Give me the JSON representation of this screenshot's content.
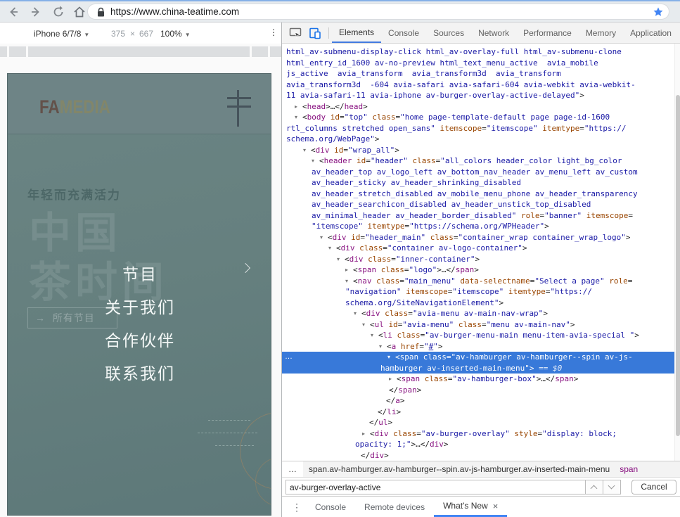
{
  "browser": {
    "url": "https://www.china-teatime.com",
    "bookmarked_star_color": "#4285f4"
  },
  "device_toolbar": {
    "device": "iPhone 6/7/8",
    "width": "375",
    "times": "×",
    "height": "667",
    "zoom": "100%"
  },
  "viewport": {
    "logo_part1": "FA",
    "logo_part2": "MEDIA",
    "tagline": "年轻而充满活力",
    "hero_line1": "中国",
    "hero_line2": "茶时间",
    "cta_arrow": "→",
    "cta_label": "所有节目",
    "menu": [
      "节目",
      "关于我们",
      "合作伙伴",
      "联系我们"
    ]
  },
  "devtools": {
    "accent_color": "#4285f4",
    "selection_color": "#3879d9",
    "tabs": [
      {
        "label": "Elements",
        "selected": true
      },
      {
        "label": "Console"
      },
      {
        "label": "Sources"
      },
      {
        "label": "Network"
      },
      {
        "label": "Performance"
      },
      {
        "label": "Memory"
      },
      {
        "label": "Application"
      }
    ],
    "code_lines": [
      {
        "ind": 6,
        "seg": [
          [
            "val",
            "html_av-submenu-display-click html_av-overlay-full html_av-submenu-clone"
          ]
        ]
      },
      {
        "ind": 6,
        "seg": [
          [
            "val",
            "html_entry_id_1600 av-no-preview html_text_menu_active  avia_mobile"
          ]
        ]
      },
      {
        "ind": 6,
        "seg": [
          [
            "val",
            "js_active  avia_transform  avia_transform3d  avia_transform"
          ]
        ]
      },
      {
        "ind": 6,
        "seg": [
          [
            "val",
            "avia_transform3d  -604 avia-safari avia-safari-604 avia-webkit avia-webkit-"
          ]
        ]
      },
      {
        "ind": 6,
        "seg": [
          [
            "val",
            "11 avia-safari-11 avia-iphone av-burger-overlay-active-delayed\""
          ],
          [
            "p",
            ">"
          ]
        ]
      },
      {
        "ind": 18,
        "seg": [
          [
            "arr",
            "▸"
          ],
          [
            "p",
            "<"
          ],
          [
            "tag",
            "head"
          ],
          [
            "p",
            ">…</"
          ],
          [
            "tag",
            "head"
          ],
          [
            "p",
            ">"
          ]
        ]
      },
      {
        "ind": 18,
        "seg": [
          [
            "arr",
            "▾"
          ],
          [
            "p",
            "<"
          ],
          [
            "tag",
            "body"
          ],
          [
            "p",
            " "
          ],
          [
            "attr",
            "id"
          ],
          [
            "p",
            "="
          ],
          [
            "val",
            "\"top\""
          ],
          [
            "p",
            " "
          ],
          [
            "attr",
            "class"
          ],
          [
            "p",
            "="
          ],
          [
            "val",
            "\"home page-template-default page page-id-1600"
          ]
        ]
      },
      {
        "ind": 6,
        "seg": [
          [
            "val",
            "rtl_columns stretched open_sans\""
          ],
          [
            "p",
            " "
          ],
          [
            "attr",
            "itemscope"
          ],
          [
            "p",
            "="
          ],
          [
            "val",
            "\"itemscope\""
          ],
          [
            "p",
            " "
          ],
          [
            "attr",
            "itemtype"
          ],
          [
            "p",
            "="
          ],
          [
            "val",
            "\"https://"
          ]
        ]
      },
      {
        "ind": 6,
        "seg": [
          [
            "val",
            "schema.org/WebPage\""
          ],
          [
            "p",
            ">"
          ]
        ]
      },
      {
        "ind": 30,
        "seg": [
          [
            "arr",
            "▾"
          ],
          [
            "p",
            "<"
          ],
          [
            "tag",
            "div"
          ],
          [
            "p",
            " "
          ],
          [
            "attr",
            "id"
          ],
          [
            "p",
            "="
          ],
          [
            "val",
            "\"wrap_all\""
          ],
          [
            "p",
            ">"
          ]
        ]
      },
      {
        "ind": 42,
        "seg": [
          [
            "arr",
            "▾"
          ],
          [
            "p",
            "<"
          ],
          [
            "tag",
            "header"
          ],
          [
            "p",
            " "
          ],
          [
            "attr",
            "id"
          ],
          [
            "p",
            "="
          ],
          [
            "val",
            "\"header\""
          ],
          [
            "p",
            " "
          ],
          [
            "attr",
            "class"
          ],
          [
            "p",
            "="
          ],
          [
            "val",
            "\"all_colors header_color light_bg_color"
          ]
        ]
      },
      {
        "ind": 42,
        "seg": [
          [
            "val",
            "av_header_top av_logo_left av_bottom_nav_header av_menu_left av_custom"
          ]
        ]
      },
      {
        "ind": 42,
        "seg": [
          [
            "val",
            "av_header_sticky av_header_shrinking_disabled"
          ]
        ]
      },
      {
        "ind": 42,
        "seg": [
          [
            "val",
            "av_header_stretch_disabled av_mobile_menu_phone av_header_transparency"
          ]
        ]
      },
      {
        "ind": 42,
        "seg": [
          [
            "val",
            "av_header_searchicon_disabled av_header_unstick_top_disabled"
          ]
        ]
      },
      {
        "ind": 42,
        "seg": [
          [
            "val",
            "av_minimal_header av_header_border_disabled\""
          ],
          [
            "p",
            " "
          ],
          [
            "attr",
            "role"
          ],
          [
            "p",
            "="
          ],
          [
            "val",
            "\"banner\""
          ],
          [
            "p",
            " "
          ],
          [
            "attr",
            "itemscope"
          ],
          [
            "p",
            "="
          ]
        ]
      },
      {
        "ind": 42,
        "seg": [
          [
            "val",
            "\"itemscope\""
          ],
          [
            "p",
            " "
          ],
          [
            "attr",
            "itemtype"
          ],
          [
            "p",
            "="
          ],
          [
            "val",
            "\"https://schema.org/WPHeader\""
          ],
          [
            "p",
            ">"
          ]
        ]
      },
      {
        "ind": 54,
        "seg": [
          [
            "arr",
            "▾"
          ],
          [
            "p",
            "<"
          ],
          [
            "tag",
            "div"
          ],
          [
            "p",
            " "
          ],
          [
            "attr",
            "id"
          ],
          [
            "p",
            "="
          ],
          [
            "val",
            "\"header_main\""
          ],
          [
            "p",
            " "
          ],
          [
            "attr",
            "class"
          ],
          [
            "p",
            "="
          ],
          [
            "val",
            "\"container_wrap container_wrap_logo\""
          ],
          [
            "p",
            ">"
          ]
        ]
      },
      {
        "ind": 66,
        "seg": [
          [
            "arr",
            "▾"
          ],
          [
            "p",
            "<"
          ],
          [
            "tag",
            "div"
          ],
          [
            "p",
            " "
          ],
          [
            "attr",
            "class"
          ],
          [
            "p",
            "="
          ],
          [
            "val",
            "\"container av-logo-container\""
          ],
          [
            "p",
            ">"
          ]
        ]
      },
      {
        "ind": 78,
        "seg": [
          [
            "arr",
            "▾"
          ],
          [
            "p",
            "<"
          ],
          [
            "tag",
            "div"
          ],
          [
            "p",
            " "
          ],
          [
            "attr",
            "class"
          ],
          [
            "p",
            "="
          ],
          [
            "val",
            "\"inner-container\""
          ],
          [
            "p",
            ">"
          ]
        ]
      },
      {
        "ind": 90,
        "seg": [
          [
            "arr",
            "▸"
          ],
          [
            "p",
            "<"
          ],
          [
            "tag",
            "span"
          ],
          [
            "p",
            " "
          ],
          [
            "attr",
            "class"
          ],
          [
            "p",
            "="
          ],
          [
            "val",
            "\"logo\""
          ],
          [
            "p",
            ">…</"
          ],
          [
            "tag",
            "span"
          ],
          [
            "p",
            ">"
          ]
        ]
      },
      {
        "ind": 90,
        "seg": [
          [
            "arr",
            "▾"
          ],
          [
            "p",
            "<"
          ],
          [
            "tag",
            "nav"
          ],
          [
            "p",
            " "
          ],
          [
            "attr",
            "class"
          ],
          [
            "p",
            "="
          ],
          [
            "val",
            "\"main_menu\""
          ],
          [
            "p",
            " "
          ],
          [
            "attr",
            "data-selectname"
          ],
          [
            "p",
            "="
          ],
          [
            "val",
            "\"Select a page\""
          ],
          [
            "p",
            " "
          ],
          [
            "attr",
            "role"
          ],
          [
            "p",
            "="
          ]
        ]
      },
      {
        "ind": 90,
        "seg": [
          [
            "val",
            "\"navigation\""
          ],
          [
            "p",
            " "
          ],
          [
            "attr",
            "itemscope"
          ],
          [
            "p",
            "="
          ],
          [
            "val",
            "\"itemscope\""
          ],
          [
            "p",
            " "
          ],
          [
            "attr",
            "itemtype"
          ],
          [
            "p",
            "="
          ],
          [
            "val",
            "\"https://"
          ]
        ]
      },
      {
        "ind": 90,
        "seg": [
          [
            "val",
            "schema.org/SiteNavigationElement\""
          ],
          [
            "p",
            ">"
          ]
        ]
      },
      {
        "ind": 102,
        "seg": [
          [
            "arr",
            "▾"
          ],
          [
            "p",
            "<"
          ],
          [
            "tag",
            "div"
          ],
          [
            "p",
            " "
          ],
          [
            "attr",
            "class"
          ],
          [
            "p",
            "="
          ],
          [
            "val",
            "\"avia-menu av-main-nav-wrap\""
          ],
          [
            "p",
            ">"
          ]
        ]
      },
      {
        "ind": 114,
        "seg": [
          [
            "arr",
            "▾"
          ],
          [
            "p",
            "<"
          ],
          [
            "tag",
            "ul"
          ],
          [
            "p",
            " "
          ],
          [
            "attr",
            "id"
          ],
          [
            "p",
            "="
          ],
          [
            "val",
            "\"avia-menu\""
          ],
          [
            "p",
            " "
          ],
          [
            "attr",
            "class"
          ],
          [
            "p",
            "="
          ],
          [
            "val",
            "\"menu av-main-nav\""
          ],
          [
            "p",
            ">"
          ]
        ]
      },
      {
        "ind": 126,
        "seg": [
          [
            "arr",
            "▾"
          ],
          [
            "p",
            "<"
          ],
          [
            "tag",
            "li"
          ],
          [
            "p",
            " "
          ],
          [
            "attr",
            "class"
          ],
          [
            "p",
            "="
          ],
          [
            "val",
            "\"av-burger-menu-main menu-item-avia-special \""
          ],
          [
            "p",
            ">"
          ]
        ]
      },
      {
        "ind": 138,
        "seg": [
          [
            "arr",
            "▾"
          ],
          [
            "p",
            "<"
          ],
          [
            "tag",
            "a"
          ],
          [
            "p",
            " "
          ],
          [
            "attr",
            "href"
          ],
          [
            "p",
            "="
          ],
          [
            "val",
            "\""
          ],
          [
            "link",
            "#"
          ],
          [
            "val",
            "\""
          ],
          [
            "p",
            ">"
          ]
        ]
      },
      {
        "ind": 150,
        "sel": true,
        "gutter": true,
        "seg": [
          [
            "arr",
            "▾"
          ],
          [
            "p",
            "<"
          ],
          [
            "tag",
            "span"
          ],
          [
            "p",
            " "
          ],
          [
            "attr",
            "class"
          ],
          [
            "p",
            "="
          ],
          [
            "val",
            "\"av-hamburger av-hamburger--spin av-js-"
          ]
        ]
      },
      {
        "ind": 140,
        "sel": true,
        "seg": [
          [
            "val",
            "hamburger av-inserted-main-menu\""
          ],
          [
            "p",
            ">"
          ],
          [
            "dim",
            " == $0"
          ]
        ]
      },
      {
        "ind": 152,
        "seg": [
          [
            "arr",
            "▸"
          ],
          [
            "p",
            "<"
          ],
          [
            "tag",
            "span"
          ],
          [
            "p",
            " "
          ],
          [
            "attr",
            "class"
          ],
          [
            "p",
            "="
          ],
          [
            "val",
            "\"av-hamburger-box\""
          ],
          [
            "p",
            ">…</"
          ],
          [
            "tag",
            "span"
          ],
          [
            "p",
            ">"
          ]
        ]
      },
      {
        "ind": 152,
        "seg": [
          [
            "p",
            "</"
          ],
          [
            "tag",
            "span"
          ],
          [
            "p",
            ">"
          ]
        ]
      },
      {
        "ind": 148,
        "seg": [
          [
            "p",
            "</"
          ],
          [
            "tag",
            "a"
          ],
          [
            "p",
            ">"
          ]
        ]
      },
      {
        "ind": 136,
        "seg": [
          [
            "p",
            "</"
          ],
          [
            "tag",
            "li"
          ],
          [
            "p",
            ">"
          ]
        ]
      },
      {
        "ind": 124,
        "seg": [
          [
            "p",
            "</"
          ],
          [
            "tag",
            "ul"
          ],
          [
            "p",
            ">"
          ]
        ]
      },
      {
        "ind": 114,
        "seg": [
          [
            "arr",
            "▸"
          ],
          [
            "p",
            "<"
          ],
          [
            "tag",
            "div"
          ],
          [
            "p",
            " "
          ],
          [
            "attr",
            "class"
          ],
          [
            "p",
            "="
          ],
          [
            "val",
            "\"av-burger-overlay\""
          ],
          [
            "p",
            " "
          ],
          [
            "attr",
            "style"
          ],
          [
            "p",
            "="
          ],
          [
            "val",
            "\"display: block;"
          ]
        ]
      },
      {
        "ind": 104,
        "seg": [
          [
            "val",
            "opacity: 1;\""
          ],
          [
            "p",
            ">…</"
          ],
          [
            "tag",
            "div"
          ],
          [
            "p",
            ">"
          ]
        ]
      },
      {
        "ind": 112,
        "seg": [
          [
            "p",
            "</"
          ],
          [
            "tag",
            "div"
          ],
          [
            "p",
            ">"
          ]
        ]
      }
    ],
    "breadcrumbs": [
      {
        "label": "…",
        "kind": "more"
      },
      {
        "label": "span.av-hamburger.av-hamburger--spin.av-js-hamburger.av-inserted-main-menu",
        "kind": "current"
      },
      {
        "label": "span",
        "kind": "tag"
      }
    ],
    "search": {
      "value": "av-burger-overlay-active",
      "cancel_label": "Cancel"
    },
    "drawer_tabs": [
      {
        "label": "Console"
      },
      {
        "label": "Remote devices"
      },
      {
        "label": "What's New",
        "selected": true,
        "closable": true
      }
    ]
  }
}
